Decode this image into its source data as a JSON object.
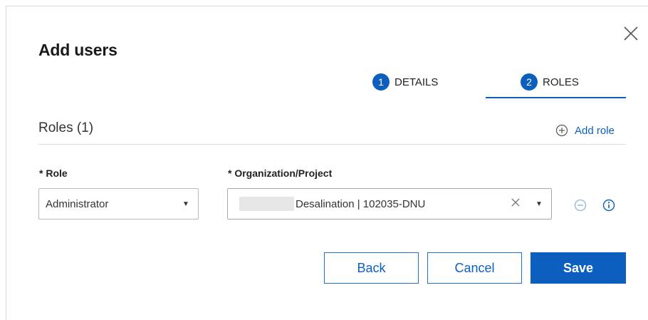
{
  "dialog": {
    "title": "Add users",
    "close_icon": "close-icon"
  },
  "steps": [
    {
      "number": "1",
      "label": "DETAILS",
      "active": false
    },
    {
      "number": "2",
      "label": "ROLES",
      "active": true
    }
  ],
  "roles_section": {
    "title": "Roles (1)",
    "add_role_label": "Add role",
    "add_role_icon": "plus-circle-icon"
  },
  "form": {
    "role_label": "* Role",
    "role_value": "Administrator",
    "org_label": "* Organization/Project",
    "org_value": "Desalination | 102035-DNU"
  },
  "buttons": {
    "back": "Back",
    "cancel": "Cancel",
    "save": "Save"
  },
  "colors": {
    "accent": "#0c5fbf",
    "border": "#b9b9b9"
  }
}
